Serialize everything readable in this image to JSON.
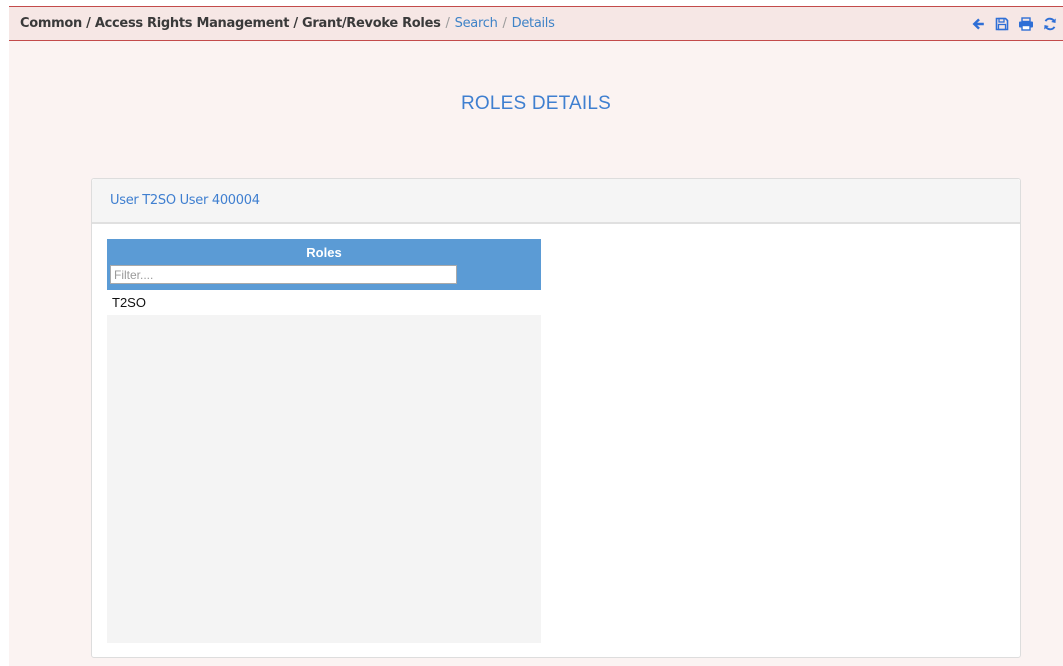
{
  "breadcrumb": {
    "static": "Common / Access Rights Management / Grant/Revoke Roles",
    "sep1": "/",
    "search": "Search",
    "sep2": "/",
    "details": "Details"
  },
  "toolbar": {
    "icons": [
      "arrow-left-icon",
      "save-icon",
      "print-icon",
      "refresh-icon"
    ],
    "accent": "#2f6fd6"
  },
  "page": {
    "title": "ROLES DETAILS"
  },
  "panel": {
    "header": "User T2SO User 400004"
  },
  "roles": {
    "header": "Roles",
    "filter_placeholder": "Filter....",
    "filter_value": "",
    "items": [
      {
        "label": "T2SO"
      }
    ]
  },
  "colors": {
    "accent_blue": "#3f7fd0",
    "roles_header_bg": "#5b9bd5",
    "topbar_border": "#c34b4b"
  }
}
